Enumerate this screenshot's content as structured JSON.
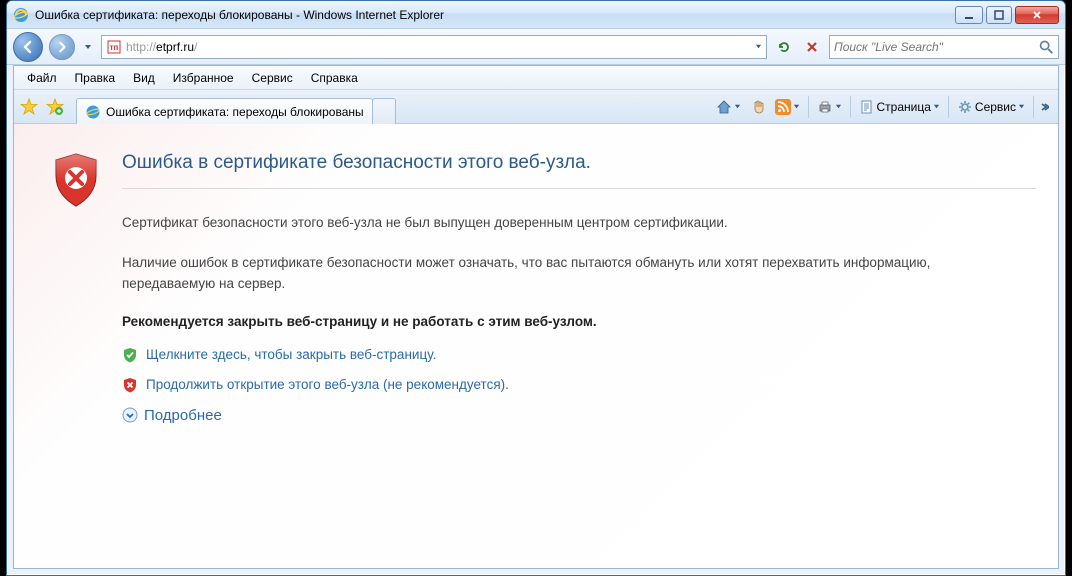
{
  "window": {
    "title": "Ошибка сертификата: переходы блокированы - Windows Internet Explorer"
  },
  "address": {
    "prefix": "http://",
    "host": "etprf.ru",
    "suffix": "/"
  },
  "search": {
    "placeholder": "Поиск \"Live Search\""
  },
  "menu": {
    "file": "Файл",
    "edit": "Правка",
    "view": "Вид",
    "favorites": "Избранное",
    "service": "Сервис",
    "help": "Справка"
  },
  "tab": {
    "title": "Ошибка сертификата: переходы блокированы"
  },
  "tools": {
    "page": "Страница",
    "service": "Сервис"
  },
  "error": {
    "heading": "Ошибка в сертификате безопасности этого веб-узла.",
    "p1": "Сертификат безопасности этого веб-узла не был выпущен доверенным центром сертификации.",
    "p2": "Наличие ошибок в сертификате безопасности может означать, что вас пытаются обмануть или хотят перехватить информацию, передаваемую на сервер.",
    "recommend": "Рекомендуется закрыть веб-страницу и не работать с этим веб-узлом.",
    "close_link": "Щелкните здесь, чтобы закрыть веб-страницу.",
    "continue_link": "Продолжить открытие этого веб-узла (не рекомендуется).",
    "more": "Подробнее"
  }
}
